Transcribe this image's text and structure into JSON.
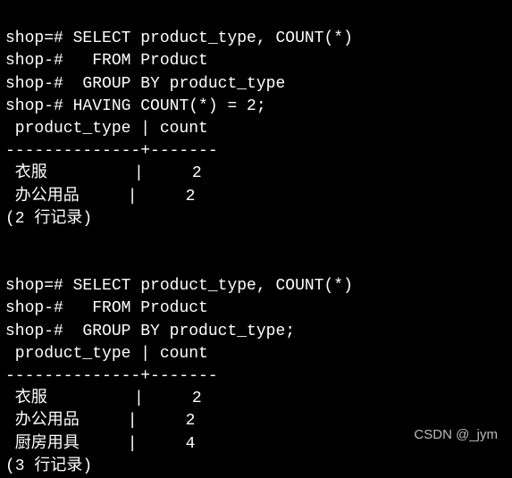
{
  "query1": {
    "lines": [
      {
        "prompt": "shop=# ",
        "text": "SELECT product_type, COUNT(*)"
      },
      {
        "prompt": "shop-# ",
        "text": "  FROM Product"
      },
      {
        "prompt": "shop-# ",
        "text": " GROUP BY product_type"
      },
      {
        "prompt": "shop-# ",
        "text": "HAVING COUNT(*) = 2;"
      }
    ],
    "header": " product_type | count",
    "divider": "--------------+-------",
    "rows": [
      {
        "col1": " 衣服         |     2",
        "product_type": "衣服",
        "count": 2
      },
      {
        "col1": " 办公用品     |     2",
        "product_type": "办公用品",
        "count": 2
      }
    ],
    "footer": "(2 行记录)"
  },
  "query2": {
    "lines": [
      {
        "prompt": "shop=# ",
        "text": "SELECT product_type, COUNT(*)"
      },
      {
        "prompt": "shop-# ",
        "text": "  FROM Product"
      },
      {
        "prompt": "shop-# ",
        "text": " GROUP BY product_type;"
      }
    ],
    "header": " product_type | count",
    "divider": "--------------+-------",
    "rows": [
      {
        "col1": " 衣服         |     2",
        "product_type": "衣服",
        "count": 2
      },
      {
        "col1": " 办公用品     |     2",
        "product_type": "办公用品",
        "count": 2
      },
      {
        "col1": " 厨房用具     |     4",
        "product_type": "厨房用具",
        "count": 4
      }
    ],
    "footer": "(3 行记录)"
  },
  "watermark": "CSDN @_jym"
}
